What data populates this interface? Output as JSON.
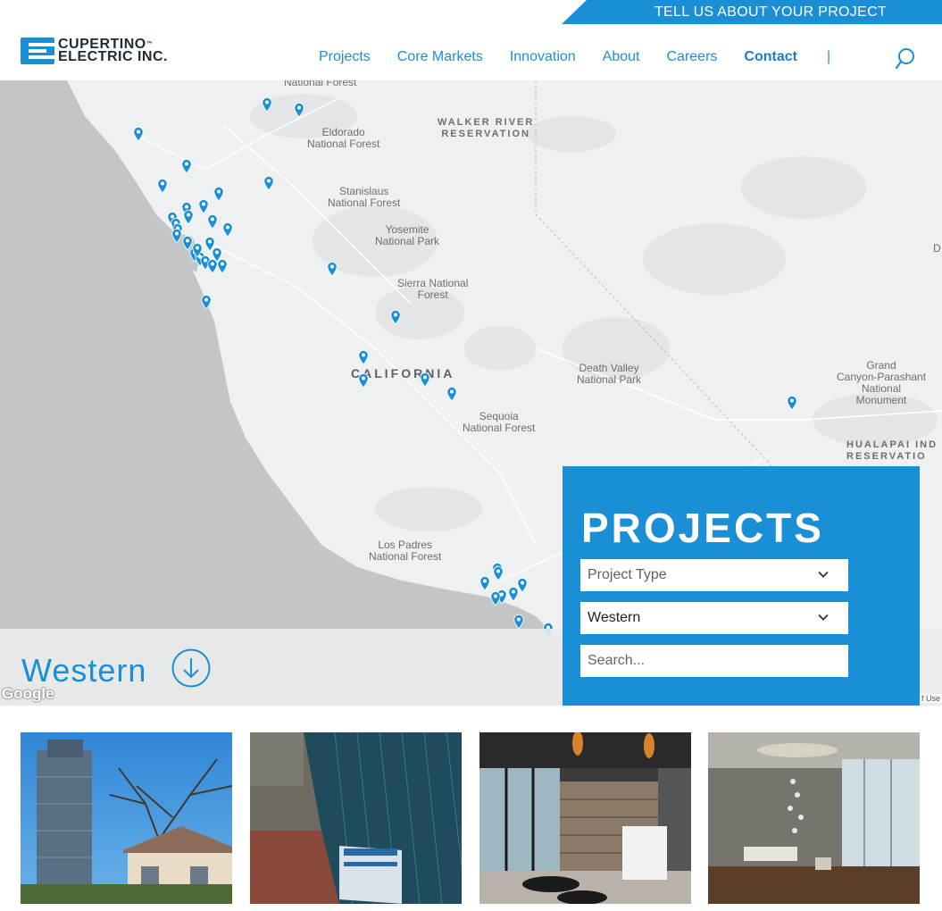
{
  "banner": {
    "label": "TELL US ABOUT YOUR PROJECT"
  },
  "logo": {
    "line1": "CUPERTINO",
    "line2": "ELECTRIC INC.",
    "tm": "™"
  },
  "nav": {
    "items": [
      {
        "label": "Projects"
      },
      {
        "label": "Core Markets"
      },
      {
        "label": "Innovation"
      },
      {
        "label": "About"
      },
      {
        "label": "Careers"
      },
      {
        "label": "Contact",
        "active": true
      }
    ],
    "separator": "|"
  },
  "map": {
    "labels": {
      "eldorado": "Eldorado\nNational Forest",
      "national_forest_top": "National Forest",
      "walker": "WALKER RIVER\nRESERVATION",
      "stanislaus": "Stanislaus\nNational Forest",
      "yosemite": "Yosemite\nNational Park",
      "sierra": "Sierra National\nForest",
      "california": "CALIFORNIA",
      "death_valley": "Death Valley\nNational Park",
      "sequoia": "Sequoia\nNational Forest",
      "grand_canyon": "Grand\nCanyon-Parashant\nNational\nMonument",
      "hualapai": "HUALAPAI IND\nRESERVATIO",
      "los_padres": "Los Padres\nNational Forest",
      "edge_d": "D"
    },
    "google": "Google",
    "terms": "f Use",
    "pin_color": "#1b8fd6"
  },
  "region": {
    "title": "Western"
  },
  "panel": {
    "title": "PROJECTS",
    "project_type": "Project Type",
    "region_select": "Western",
    "search_placeholder": "Search..."
  },
  "thumbs": [
    {
      "name": "high-rise tower with tree"
    },
    {
      "name": "tower facade aerial"
    },
    {
      "name": "lobby with wood wall"
    },
    {
      "name": "lobby with chandelier"
    }
  ],
  "colors": {
    "accent": "#1b8fd6"
  }
}
